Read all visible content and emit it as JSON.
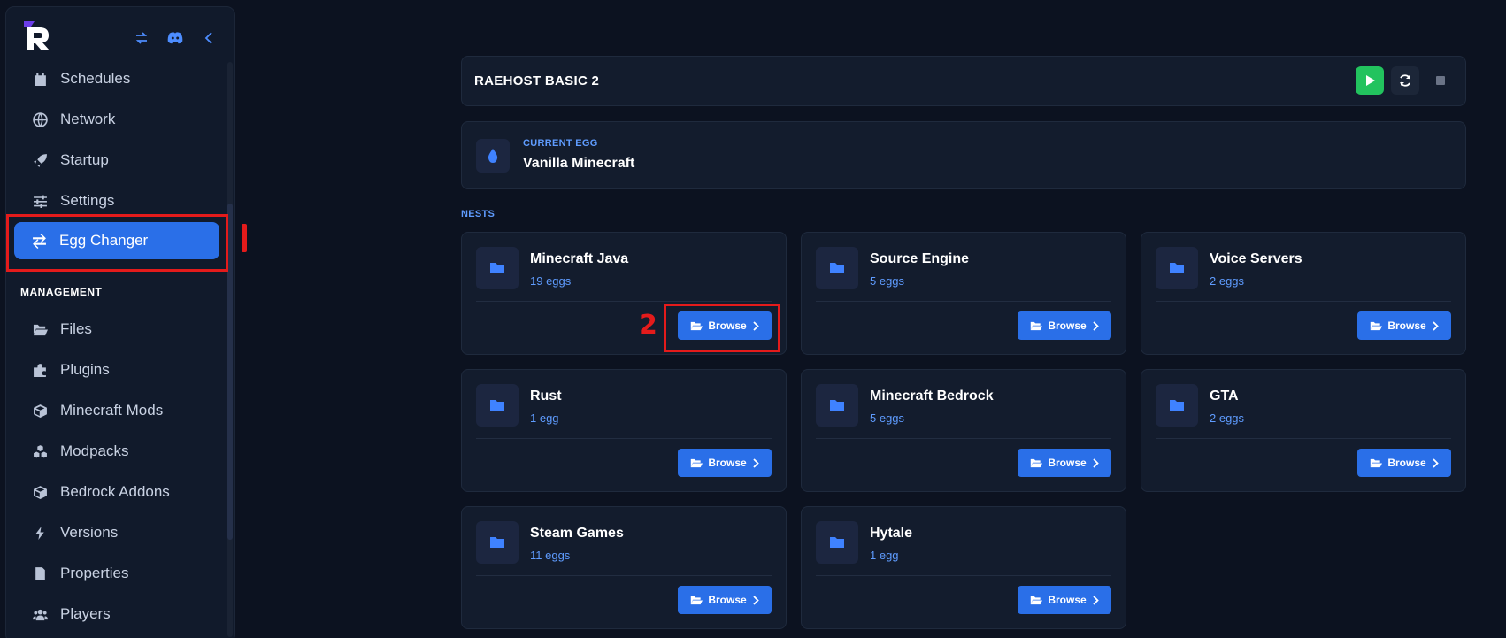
{
  "sidebar": {
    "logo_letter": "R",
    "icons": [
      "swap-icon",
      "discord-icon",
      "chevron-left-icon"
    ],
    "items": [
      {
        "label": "Schedules",
        "icon": "calendar-icon"
      },
      {
        "label": "Network",
        "icon": "globe-icon"
      },
      {
        "label": "Startup",
        "icon": "rocket-icon"
      },
      {
        "label": "Settings",
        "icon": "sliders-icon"
      },
      {
        "label": "Egg Changer",
        "icon": "swap-icon",
        "active": true
      }
    ],
    "management_label": "MANAGEMENT",
    "management_items": [
      {
        "label": "Files",
        "icon": "folder-open-icon"
      },
      {
        "label": "Plugins",
        "icon": "puzzle-icon"
      },
      {
        "label": "Minecraft Mods",
        "icon": "cube-icon"
      },
      {
        "label": "Modpacks",
        "icon": "cubes-icon"
      },
      {
        "label": "Bedrock Addons",
        "icon": "cube-icon"
      },
      {
        "label": "Versions",
        "icon": "bolt-icon"
      },
      {
        "label": "Properties",
        "icon": "file-icon"
      },
      {
        "label": "Players",
        "icon": "users-icon"
      }
    ]
  },
  "server": {
    "title": "RAEHOST BASIC 2",
    "colors": {
      "play": "#22c35e",
      "accent": "#2a6fe8"
    }
  },
  "current_egg": {
    "label": "CURRENT EGG",
    "name": "Vanilla Minecraft"
  },
  "nests_label": "NESTS",
  "nests": [
    {
      "name": "Minecraft Java",
      "count": "19 eggs",
      "button": "Browse"
    },
    {
      "name": "Source Engine",
      "count": "5 eggs",
      "button": "Browse"
    },
    {
      "name": "Voice Servers",
      "count": "2 eggs",
      "button": "Browse"
    },
    {
      "name": "Rust",
      "count": "1 egg",
      "button": "Browse"
    },
    {
      "name": "Minecraft Bedrock",
      "count": "5 eggs",
      "button": "Browse"
    },
    {
      "name": "GTA",
      "count": "2 eggs",
      "button": "Browse"
    },
    {
      "name": "Steam Games",
      "count": "11 eggs",
      "button": "Browse"
    },
    {
      "name": "Hytale",
      "count": "1 egg",
      "button": "Browse"
    }
  ],
  "annotations": {
    "step1": "1",
    "step2": "2",
    "color": "#e41b1b"
  }
}
